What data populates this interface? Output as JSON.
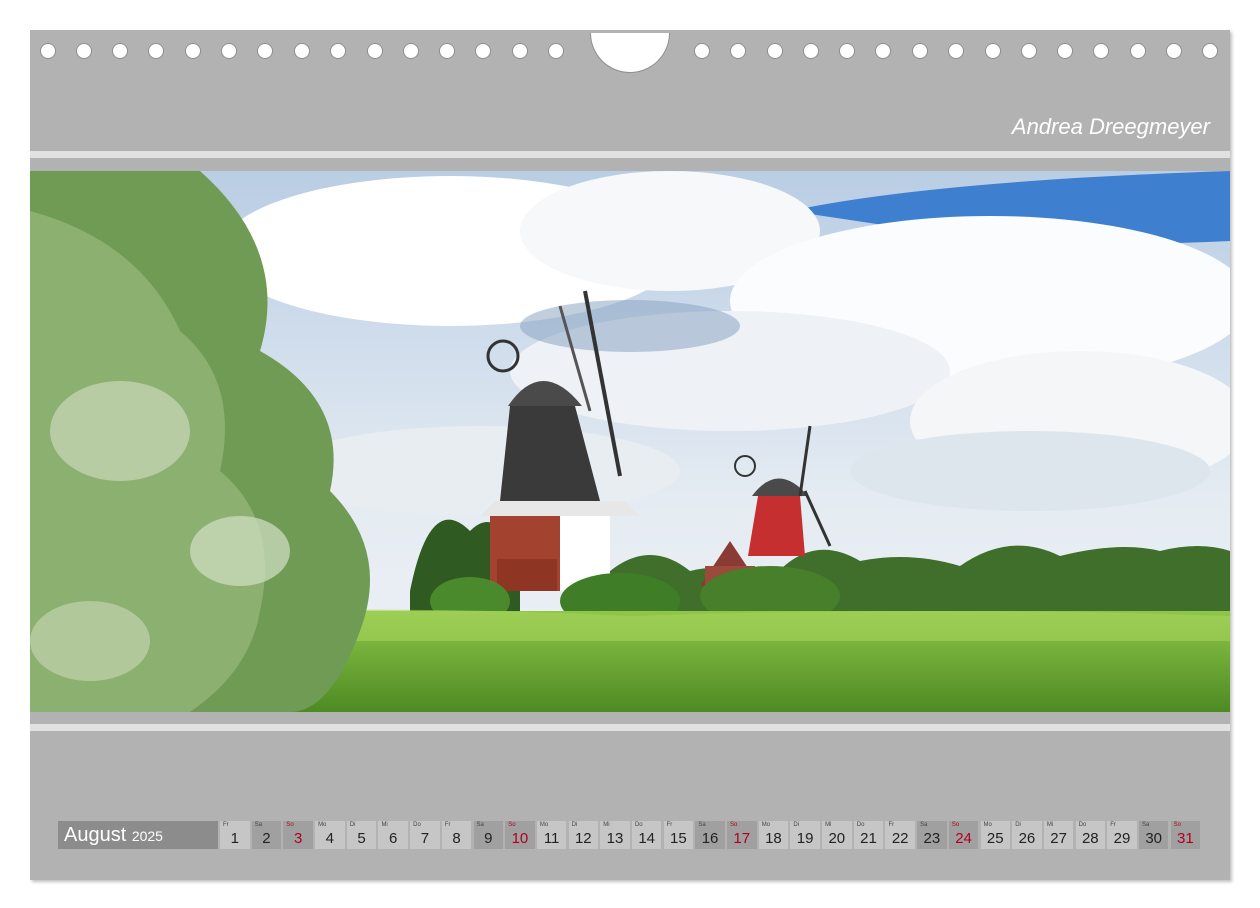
{
  "author": "Andrea Dreegmeyer",
  "calendar": {
    "month": "August",
    "year": "2025",
    "days": [
      {
        "wd": "Fr",
        "n": "1",
        "type": "weekday"
      },
      {
        "wd": "Sa",
        "n": "2",
        "type": "sat"
      },
      {
        "wd": "So",
        "n": "3",
        "type": "sun"
      },
      {
        "wd": "Mo",
        "n": "4",
        "type": "weekday"
      },
      {
        "wd": "Di",
        "n": "5",
        "type": "weekday"
      },
      {
        "wd": "Mi",
        "n": "6",
        "type": "weekday"
      },
      {
        "wd": "Do",
        "n": "7",
        "type": "weekday"
      },
      {
        "wd": "Fr",
        "n": "8",
        "type": "weekday"
      },
      {
        "wd": "Sa",
        "n": "9",
        "type": "sat"
      },
      {
        "wd": "So",
        "n": "10",
        "type": "sun"
      },
      {
        "wd": "Mo",
        "n": "11",
        "type": "weekday"
      },
      {
        "wd": "Di",
        "n": "12",
        "type": "weekday"
      },
      {
        "wd": "Mi",
        "n": "13",
        "type": "weekday"
      },
      {
        "wd": "Do",
        "n": "14",
        "type": "weekday"
      },
      {
        "wd": "Fr",
        "n": "15",
        "type": "weekday"
      },
      {
        "wd": "Sa",
        "n": "16",
        "type": "sat"
      },
      {
        "wd": "So",
        "n": "17",
        "type": "sun"
      },
      {
        "wd": "Mo",
        "n": "18",
        "type": "weekday"
      },
      {
        "wd": "Di",
        "n": "19",
        "type": "weekday"
      },
      {
        "wd": "Mi",
        "n": "20",
        "type": "weekday"
      },
      {
        "wd": "Do",
        "n": "21",
        "type": "weekday"
      },
      {
        "wd": "Fr",
        "n": "22",
        "type": "weekday"
      },
      {
        "wd": "Sa",
        "n": "23",
        "type": "sat"
      },
      {
        "wd": "So",
        "n": "24",
        "type": "sun"
      },
      {
        "wd": "Mo",
        "n": "25",
        "type": "weekday"
      },
      {
        "wd": "Di",
        "n": "26",
        "type": "weekday"
      },
      {
        "wd": "Mi",
        "n": "27",
        "type": "weekday"
      },
      {
        "wd": "Do",
        "n": "28",
        "type": "weekday"
      },
      {
        "wd": "Fr",
        "n": "29",
        "type": "weekday"
      },
      {
        "wd": "Sa",
        "n": "30",
        "type": "sat"
      },
      {
        "wd": "So",
        "n": "31",
        "type": "sun"
      }
    ]
  },
  "colors": {
    "page": "#b2b2b2",
    "sunday": "#b0001e",
    "cell": "#c6c6c6",
    "weekend_cell": "#a0a0a0"
  }
}
